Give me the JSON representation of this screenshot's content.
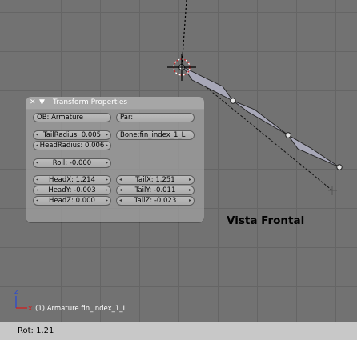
{
  "panel": {
    "title": "Transform Properties",
    "close_icon": "close-icon",
    "collapse_icon": "triangle-down-icon",
    "ob_field": "OB: Armature",
    "par_field": "Par:",
    "tail_radius": "TailRadius: 0.005",
    "head_radius": "HeadRadius: 0.006",
    "bone_field": "Bone:fin_index_1_L",
    "roll": "Roll: -0.000",
    "head_x": "HeadX: 1.214",
    "head_y": "HeadY: -0.003",
    "head_z": "HeadZ: 0.000",
    "tail_x": "TailX: 1.251",
    "tail_y": "TailY: -0.011",
    "tail_z": "TailZ: -0.023"
  },
  "viewport": {
    "annotation": "Vista Frontal",
    "status_text": "(1) Armature fin_index_1_L",
    "axis_labels": {
      "z": "z",
      "x": "x"
    }
  },
  "bottom_bar": {
    "rotation_readout": "Rot: 1.21"
  },
  "colors": {
    "viewport_bg": "#727272",
    "grid_line": "#656565",
    "bone_fill": "#a8a8b8",
    "selection_circle": "#cc2222",
    "axis_z": "#2a4ad0",
    "axis_x": "#d02020"
  }
}
